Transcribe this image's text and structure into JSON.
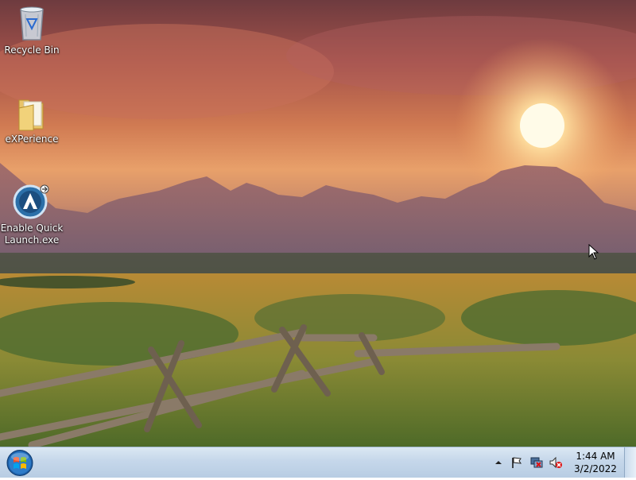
{
  "desktop": {
    "icons": [
      {
        "label": "Recycle Bin"
      },
      {
        "label": "eXPerience"
      },
      {
        "label": "Enable Quick Launch.exe"
      }
    ]
  },
  "taskbar": {
    "start_icon": "windows-start-orb",
    "tray": {
      "icons": [
        "show-hidden-icons",
        "action-center-flag",
        "network-icon",
        "volume-muted-icon"
      ]
    },
    "clock": {
      "time": "1:44 AM",
      "date": "3/2/2022"
    }
  },
  "colors": {
    "taskbar": "#c5d7ea",
    "sky_orange": "#e8a06a",
    "field_green": "#5d7a30"
  }
}
